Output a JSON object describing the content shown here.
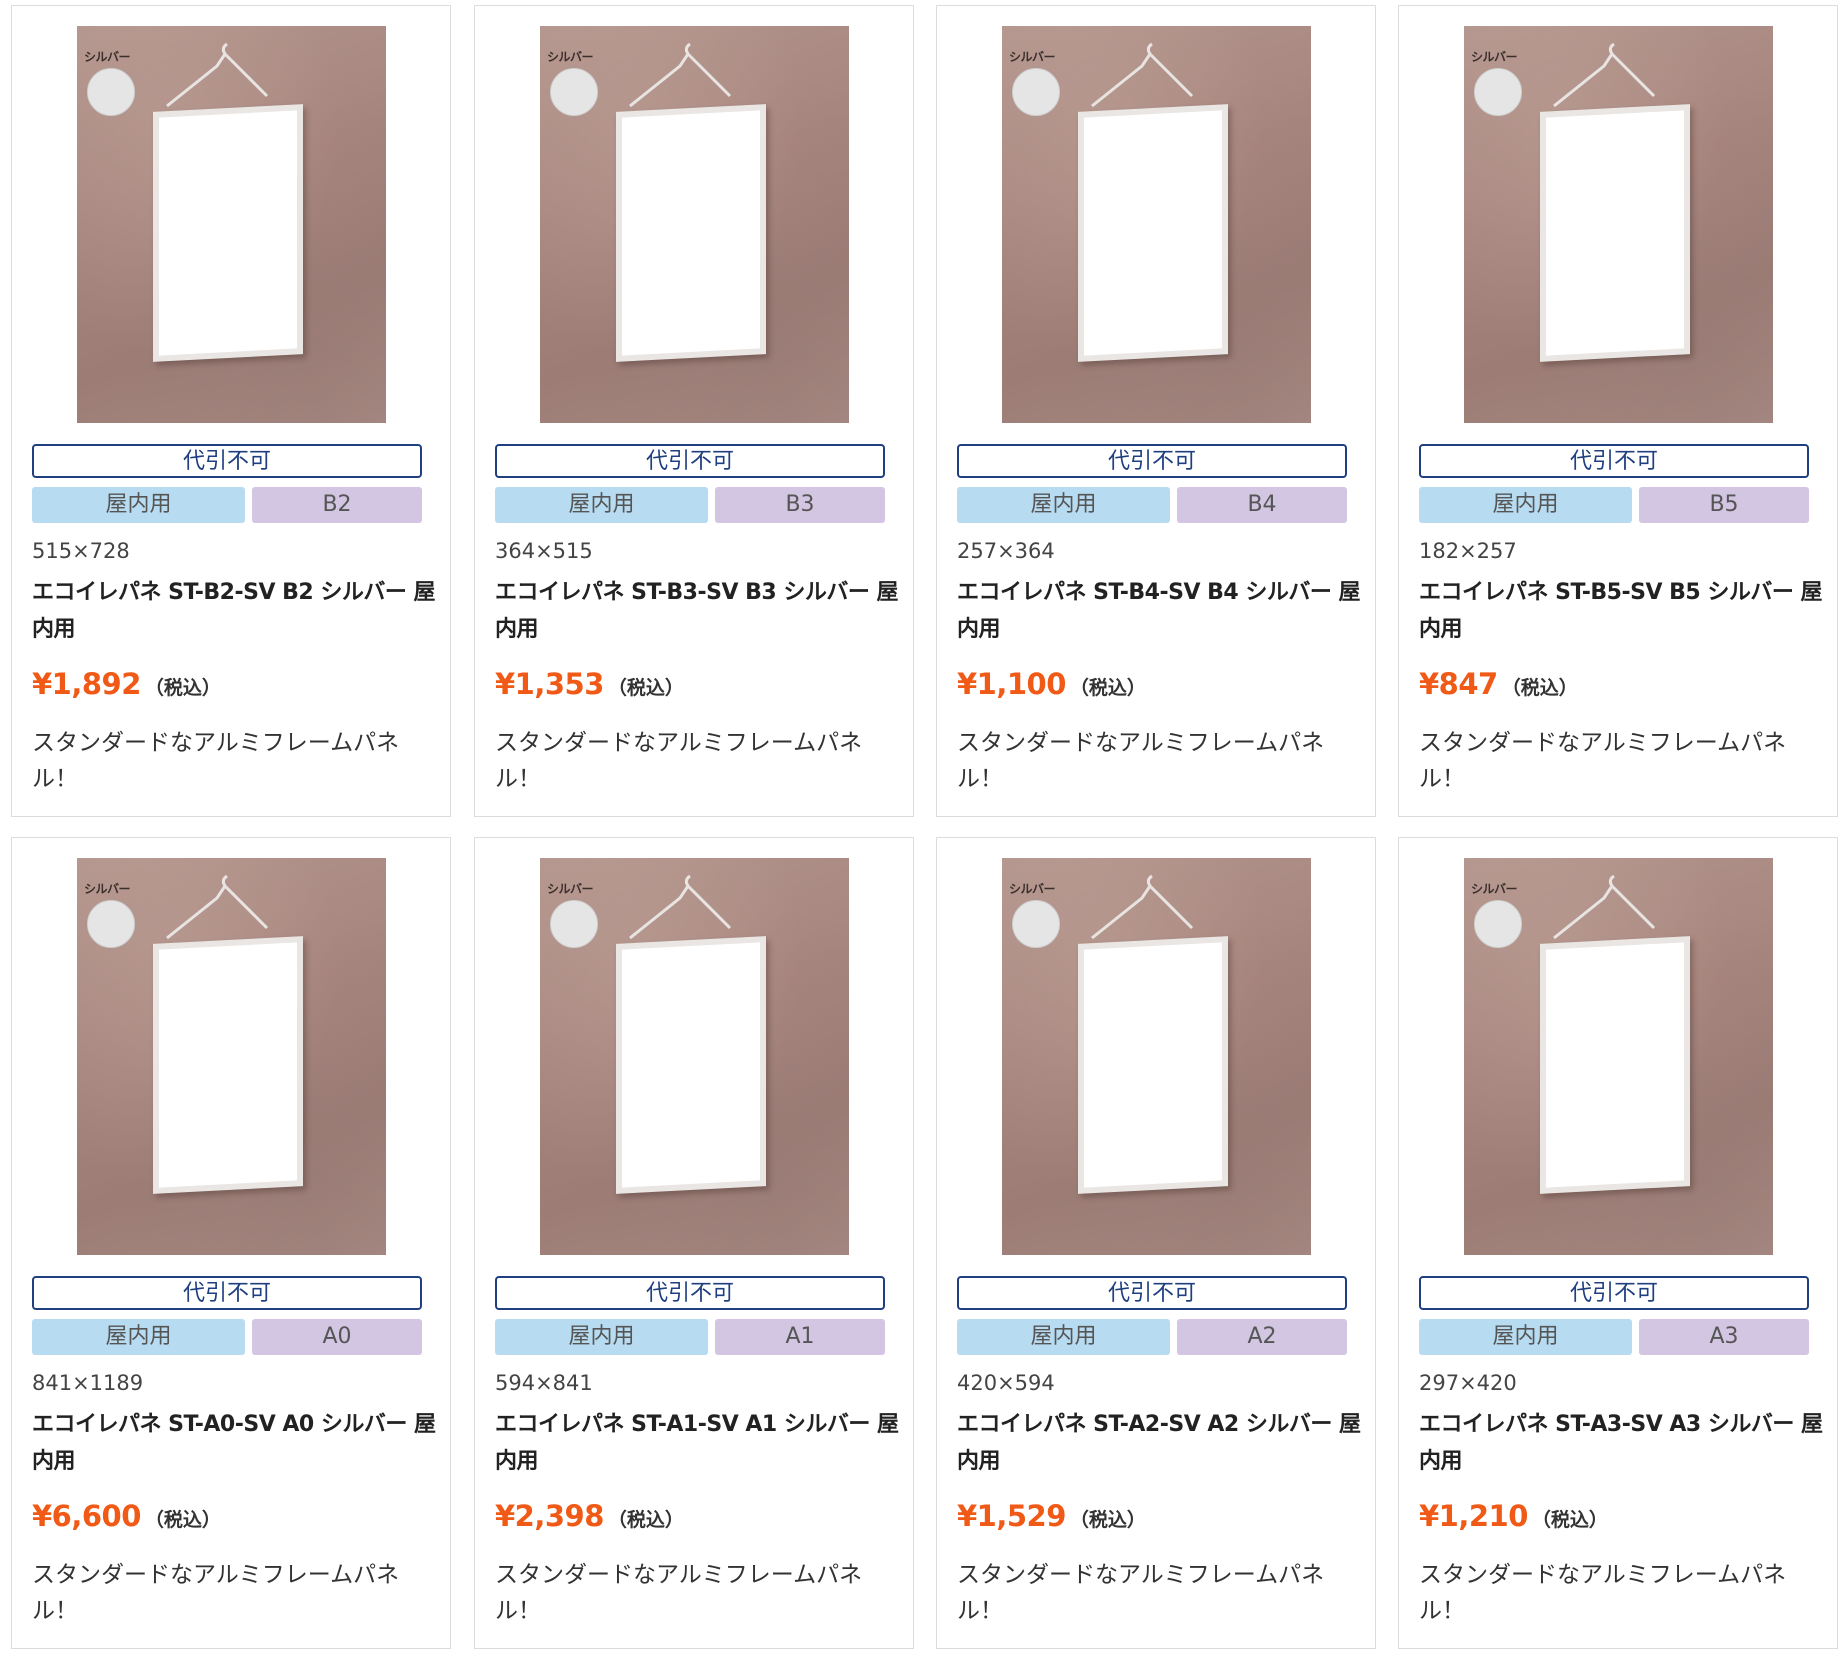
{
  "products": [
    {
      "swatch_label": "シルバー",
      "badge": "代引不可",
      "tag_indoor": "屋内用",
      "tag_size": "B2",
      "dimensions": "515×728",
      "name": "エコイレパネ ST-B2-SV B2 シルバー 屋内用",
      "price": "¥1,892",
      "tax_label": "（税込）",
      "description": "スタンダードなアルミフレームパネル！"
    },
    {
      "swatch_label": "シルバー",
      "badge": "代引不可",
      "tag_indoor": "屋内用",
      "tag_size": "B3",
      "dimensions": "364×515",
      "name": "エコイレパネ ST-B3-SV B3 シルバー 屋内用",
      "price": "¥1,353",
      "tax_label": "（税込）",
      "description": "スタンダードなアルミフレームパネル！"
    },
    {
      "swatch_label": "シルバー",
      "badge": "代引不可",
      "tag_indoor": "屋内用",
      "tag_size": "B4",
      "dimensions": "257×364",
      "name": "エコイレパネ ST-B4-SV B4 シルバー 屋内用",
      "price": "¥1,100",
      "tax_label": "（税込）",
      "description": "スタンダードなアルミフレームパネル！"
    },
    {
      "swatch_label": "シルバー",
      "badge": "代引不可",
      "tag_indoor": "屋内用",
      "tag_size": "B5",
      "dimensions": "182×257",
      "name": "エコイレパネ ST-B5-SV B5 シルバー 屋内用",
      "price": "¥847",
      "tax_label": "（税込）",
      "description": "スタンダードなアルミフレームパネル！"
    },
    {
      "swatch_label": "シルバー",
      "badge": "代引不可",
      "tag_indoor": "屋内用",
      "tag_size": "A0",
      "dimensions": "841×1189",
      "name": "エコイレパネ ST-A0-SV A0 シルバー 屋内用",
      "price": "¥6,600",
      "tax_label": "（税込）",
      "description": "スタンダードなアルミフレームパネル！"
    },
    {
      "swatch_label": "シルバー",
      "badge": "代引不可",
      "tag_indoor": "屋内用",
      "tag_size": "A1",
      "dimensions": "594×841",
      "name": "エコイレパネ ST-A1-SV A1 シルバー 屋内用",
      "price": "¥2,398",
      "tax_label": "（税込）",
      "description": "スタンダードなアルミフレームパネル！"
    },
    {
      "swatch_label": "シルバー",
      "badge": "代引不可",
      "tag_indoor": "屋内用",
      "tag_size": "A2",
      "dimensions": "420×594",
      "name": "エコイレパネ ST-A2-SV A2 シルバー 屋内用",
      "price": "¥1,529",
      "tax_label": "（税込）",
      "description": "スタンダードなアルミフレームパネル！"
    },
    {
      "swatch_label": "シルバー",
      "badge": "代引不可",
      "tag_indoor": "屋内用",
      "tag_size": "A3",
      "dimensions": "297×420",
      "name": "エコイレパネ ST-A3-SV A3 シルバー 屋内用",
      "price": "¥1,210",
      "tax_label": "（税込）",
      "description": "スタンダードなアルミフレームパネル！"
    }
  ],
  "colors": {
    "price": "#f05a16",
    "badge_border": "#1f3f80",
    "tag_indoor_bg": "#b7dbf0",
    "tag_size_bg": "#d2c6e2",
    "swatch_silver": "#e5e5e5"
  }
}
